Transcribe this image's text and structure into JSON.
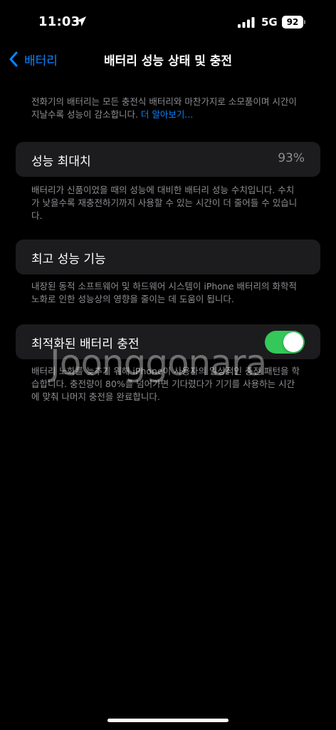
{
  "status_bar": {
    "time": "11:03",
    "network": "5G",
    "battery_level": "92",
    "icons": [
      "location-arrow-icon",
      "signal-bars-icon",
      "battery-icon"
    ]
  },
  "nav": {
    "back_label": "배터리",
    "title": "배터리 성능 상태 및 충전"
  },
  "intro": {
    "text": "전화기의 배터리는 모든 충전식 배터리와 마찬가지로 소모품이며 시간이 지날수록 성능이 감소합니다. ",
    "link": "더 알아보기..."
  },
  "max_capacity": {
    "label": "성능 최대치",
    "value": "93%",
    "footnote": "배터리가 신품이었을 때의 성능에 대비한 배터리 성능 수치입니다. 수치가 낮을수록 재충전하기까지 사용할 수 있는 시간이 더 줄어들 수 있습니다."
  },
  "peak_performance": {
    "label": "최고 성능 기능",
    "footnote": "내장된 동적 소프트웨어 및 하드웨어 시스템이 iPhone 배터리의 화학적 노화로 인한 성능상의 영향을 줄이는 데 도움이 됩니다."
  },
  "optimized_charging": {
    "label": "최적화된 배터리 충전",
    "enabled": true,
    "footnote": "배터리 노화를 늦추기 위해 iPhone이 사용자의 일상적인 충전 패턴을 학습합니다. 충전량이 80%를 넘어가면 기다렸다가 기기를 사용하는 시간에 맞춰 나머지 충전을 완료합니다."
  },
  "watermark": "Joonggonara",
  "colors": {
    "accent": "#0a84ff",
    "toggle_on": "#34c759",
    "cell_bg": "#1c1c1e",
    "secondary_text": "#8e8e93",
    "background": "#000000"
  }
}
